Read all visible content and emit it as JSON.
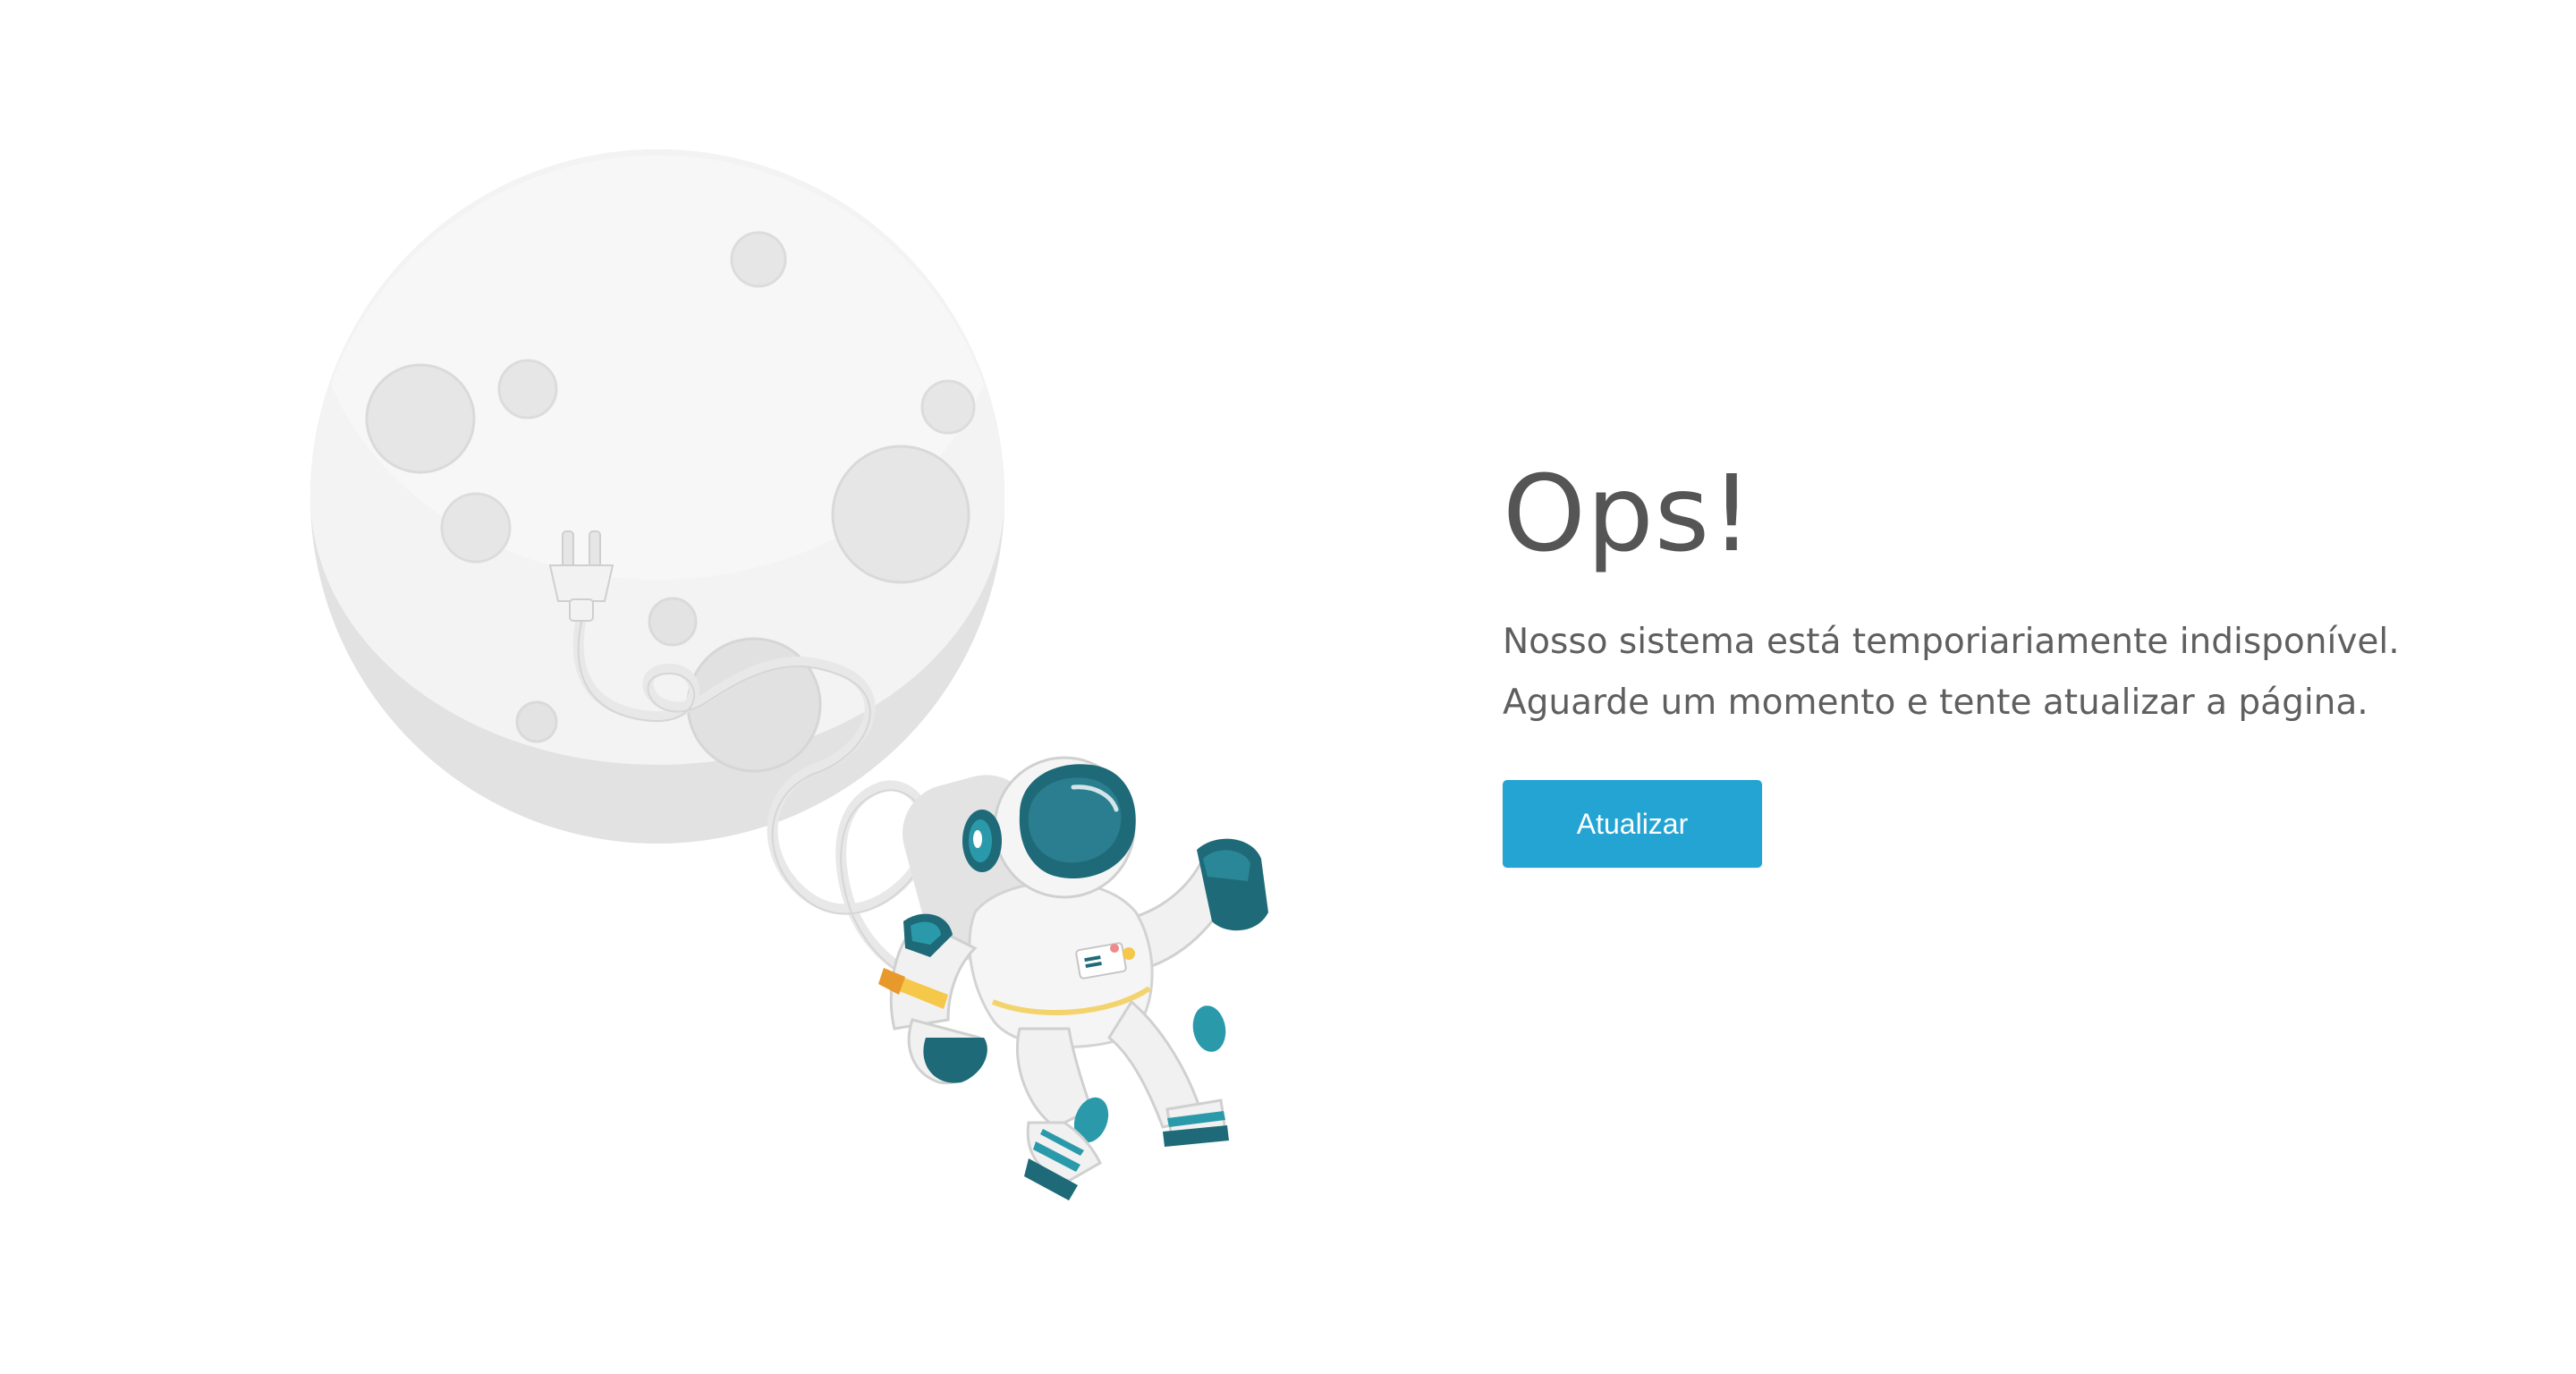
{
  "error": {
    "title": "Ops!",
    "line1": "Nosso sistema está temporiariamente indisponível.",
    "line2": "Aguarde um momento e tente atualizar a página.",
    "button_label": "Atualizar"
  },
  "illustration": {
    "icons": [
      "moon-icon",
      "power-plug-icon",
      "astronaut-icon"
    ]
  },
  "colors": {
    "button": "#24a4d3",
    "title": "#555555",
    "text": "#5f5f5f",
    "moon": "#eeeeee",
    "astronaut_teal": "#2a9aab",
    "astronaut_dark": "#1f6a78"
  }
}
